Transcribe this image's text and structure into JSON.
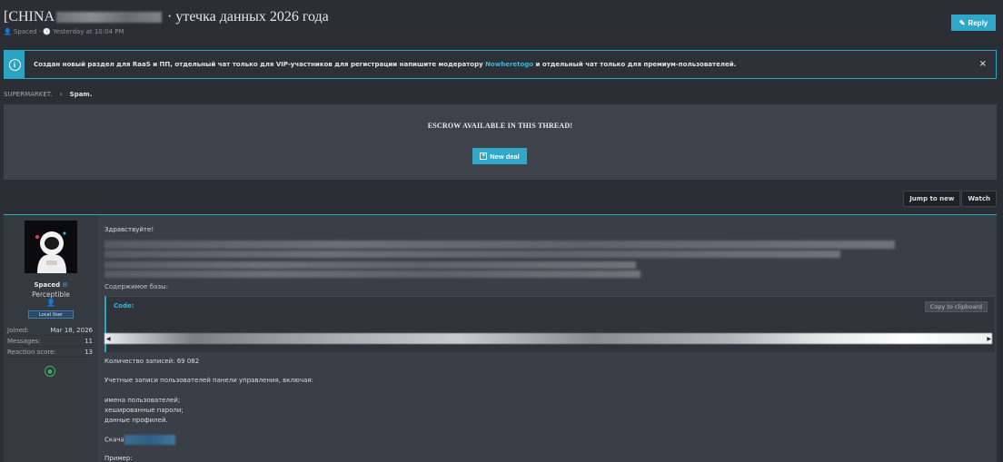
{
  "thread": {
    "title_prefix": "[CHINA",
    "title_suffix": "утечка данных 2026 года",
    "author": "Spaced",
    "time": "Yesterday at 10:04 PM",
    "reply_label": "Reply"
  },
  "notice": {
    "text_before": "Создан новый раздел для RaaS и ПП, отдельный чат только для VIP-участников для регистрации напишите модератору ",
    "link_text": "Nowheretogo",
    "text_after": " и отдельный чат только для премиум-пользователей.",
    "close": "×"
  },
  "breadcrumb": {
    "items": [
      "SUPERMARKET.",
      "Spam."
    ],
    "separator": "›"
  },
  "escrow": {
    "title": "ESCROW AVAILABLE IN THIS THREAD!",
    "button_label": "New deal"
  },
  "actions": {
    "jump": "Jump to new",
    "watch": "Watch"
  },
  "post": {
    "user": {
      "name": "Spaced",
      "title": "Perceptible",
      "banner": "Local User",
      "stats": [
        {
          "label": "Joined:",
          "value": "Mar 18, 2026"
        },
        {
          "label": "Messages:",
          "value": "11"
        },
        {
          "label": "Reaction score:",
          "value": "13"
        }
      ]
    },
    "greeting": "Здравствуйте!",
    "file_contents": "Содержимое базы:",
    "code_label": "Code:",
    "copy_label": "Copy to clipboard",
    "records": "Количество записей: 69 082",
    "accounts": "Учетные записи пользователей панели управления, включая:",
    "list": [
      "имена пользователей;",
      "хешированные пароли;",
      "данные профилей."
    ],
    "download": "Скача",
    "example": "Пример:"
  }
}
